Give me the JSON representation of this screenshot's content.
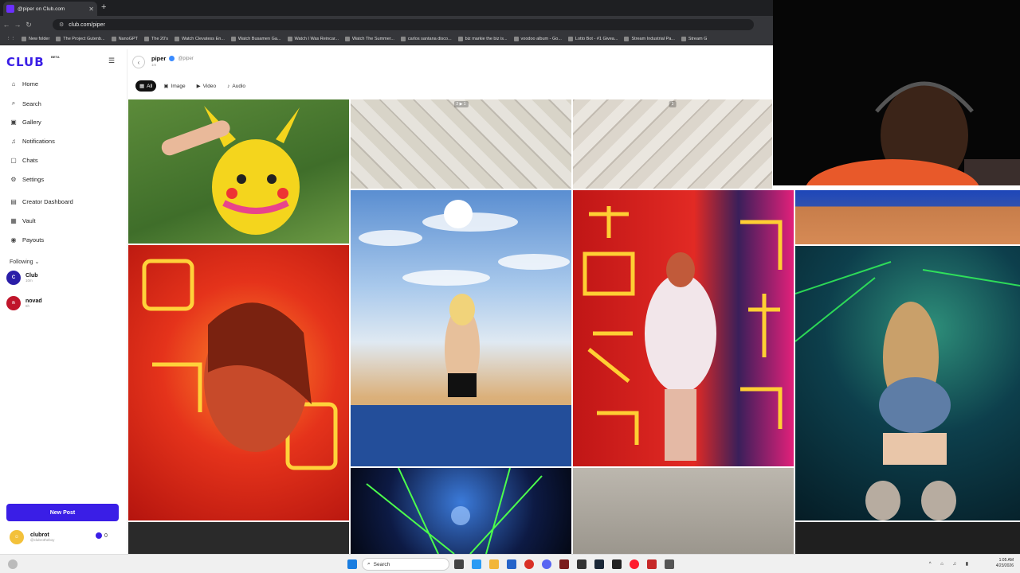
{
  "browser": {
    "tab_title": "@piper on Club.com",
    "url": "club.com/piper",
    "bookmarks": [
      "New folder",
      "The Project Gutenb...",
      "NanoGPT",
      "The 20's",
      "Watch Clevatess En...",
      "Watch Busamen Ga...",
      "Watch I Was Reincar...",
      "Watch The Summer...",
      "carlos santana disco...",
      "biz markie the biz is...",
      "voodoo album - Go...",
      "Lotto Bot - #1 Givea...",
      "Stream Industrial Pa...",
      "Stream G"
    ]
  },
  "sidebar": {
    "logo": "CLUB",
    "logo_badge": "BETA",
    "nav": [
      {
        "label": "Home",
        "icon": "home-icon"
      },
      {
        "label": "Search",
        "icon": "search-icon"
      },
      {
        "label": "Gallery",
        "icon": "gallery-icon"
      },
      {
        "label": "Notifications",
        "icon": "bell-icon"
      },
      {
        "label": "Chats",
        "icon": "chat-icon"
      },
      {
        "label": "Settings",
        "icon": "gear-icon"
      },
      {
        "label": "Creator Dashboard",
        "icon": "dashboard-icon"
      },
      {
        "label": "Vault",
        "icon": "vault-icon"
      },
      {
        "label": "Payouts",
        "icon": "payout-icon"
      }
    ],
    "following_label": "Following",
    "following": [
      {
        "name": "Club",
        "sub": "10m",
        "color": "#2a1ea8"
      },
      {
        "name": "novad",
        "sub": "6h",
        "color": "#c0152b"
      }
    ],
    "new_post": "New Post",
    "me": {
      "name": "clubrot",
      "handle": "@clubrotheboy",
      "count": "0"
    }
  },
  "header": {
    "name": "piper",
    "handle": "@piper",
    "time": "1m",
    "filters": [
      "All",
      "Image",
      "Video",
      "Audio"
    ],
    "active_filter": "All"
  },
  "grid": {
    "counts": {
      "cell2": "2 ▶ 1",
      "cell3": "2"
    }
  },
  "taskbar": {
    "search_placeholder": "Search",
    "time": "1:05 AM",
    "date": "4/23/2026"
  }
}
